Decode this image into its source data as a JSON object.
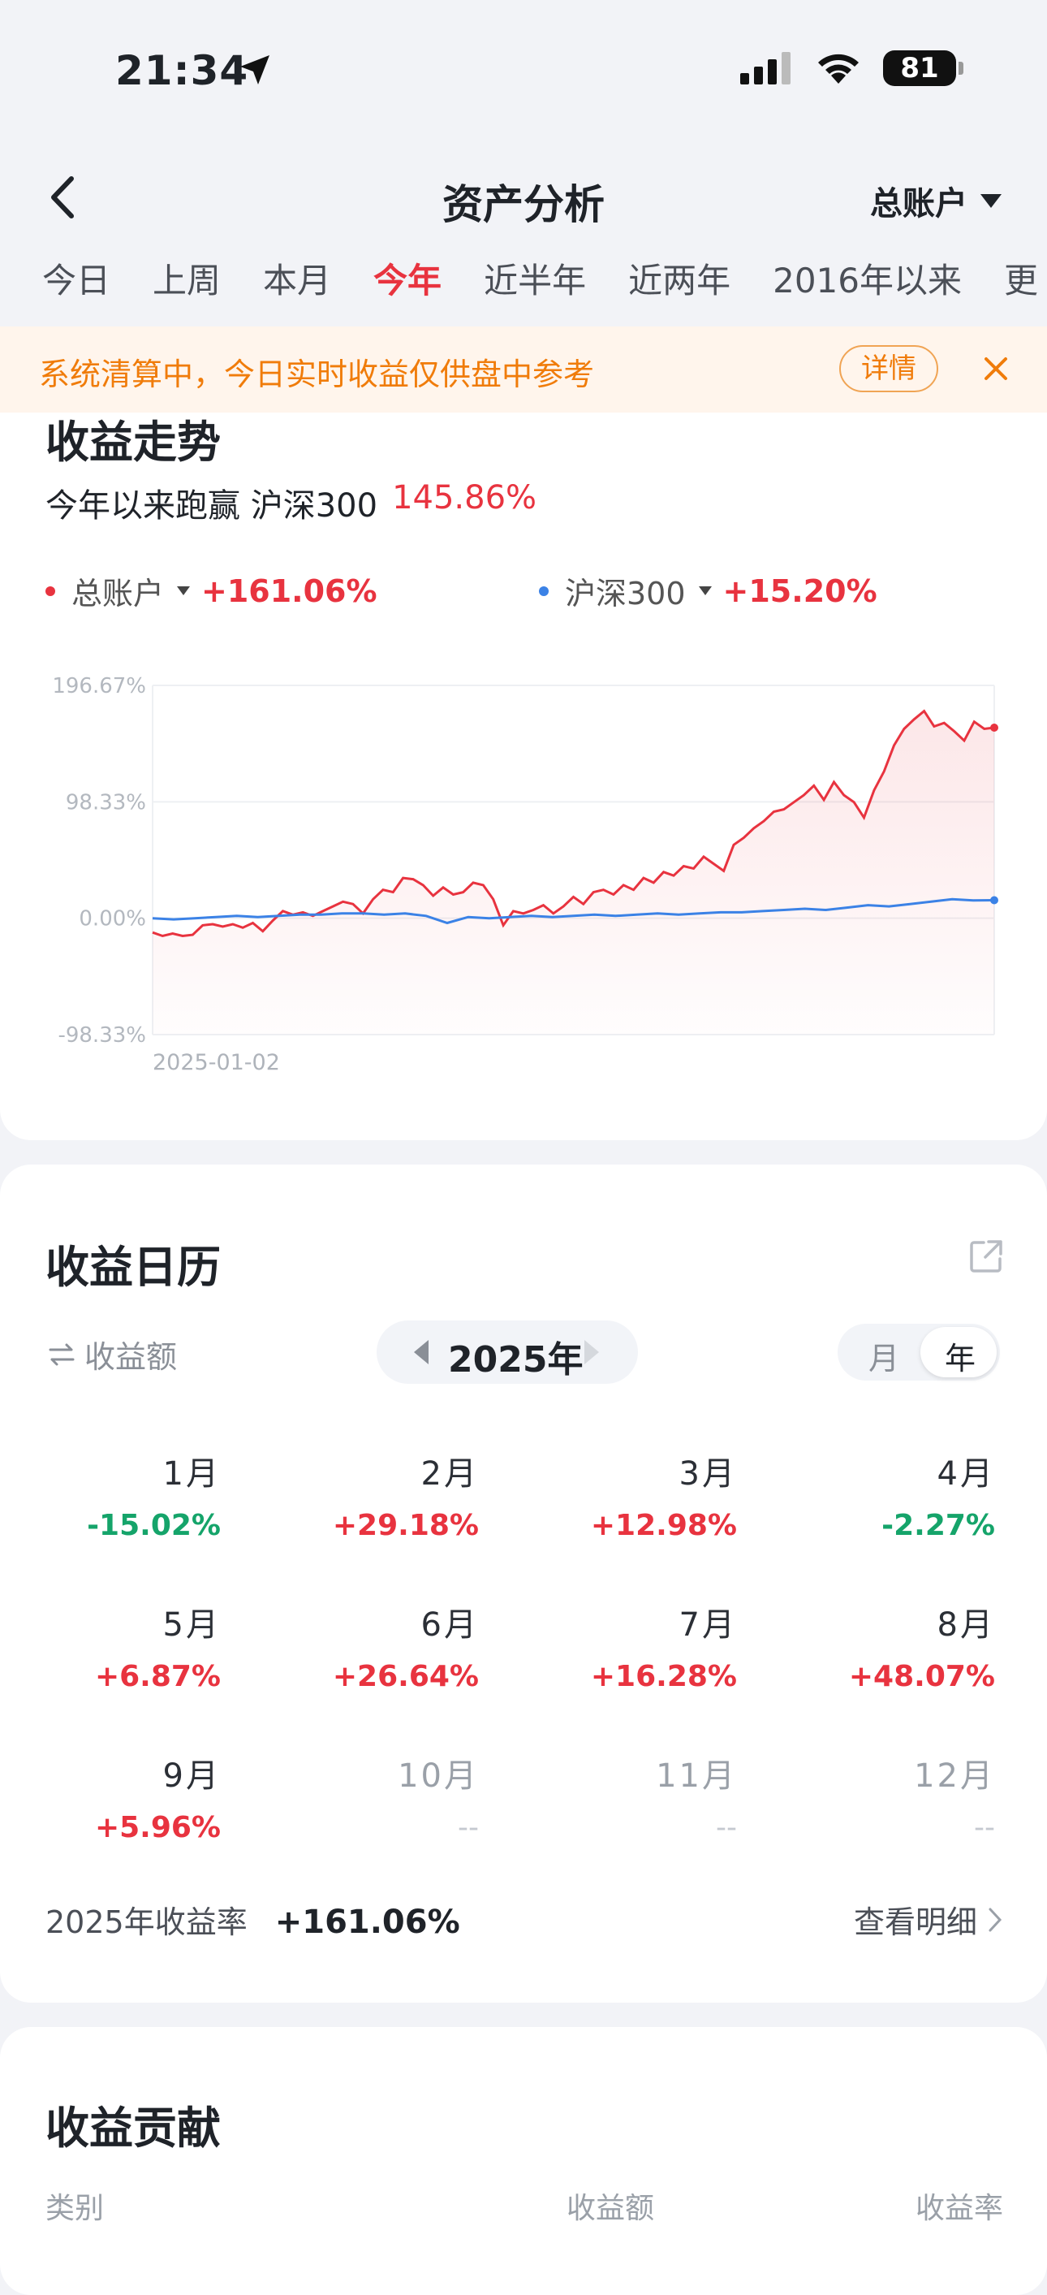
{
  "status_bar": {
    "time": "21:34",
    "battery": "81"
  },
  "nav": {
    "title": "资产分析",
    "account": "总账户"
  },
  "tabs": [
    {
      "label": "今日"
    },
    {
      "label": "上周"
    },
    {
      "label": "本月"
    },
    {
      "label": "今年",
      "active": true
    },
    {
      "label": "近半年"
    },
    {
      "label": "近两年"
    },
    {
      "label": "2016年以来"
    },
    {
      "label": "更"
    }
  ],
  "notice": {
    "text": "系统清算中，今日实时收益仅供盘中参考",
    "detail_label": "详情"
  },
  "trend": {
    "title": "收益走势",
    "summary_prefix": "今年以来跑赢 沪深300",
    "summary_value": "145.86%",
    "legend": [
      {
        "name": "总账户",
        "value": "+161.06%",
        "color": "#e8333f"
      },
      {
        "name": "沪深300",
        "value": "+15.20%",
        "color": "#3b82e6"
      }
    ]
  },
  "chart_data": {
    "type": "area",
    "ylim": [
      -98.33,
      196.67
    ],
    "y_ticks": [
      "196.67%",
      "98.33%",
      "0.00%",
      "-98.33%"
    ],
    "x_start_label": "2025-01-02",
    "grid": true,
    "series": [
      {
        "name": "总账户",
        "color": "#e8333f",
        "values": [
          -12,
          -15,
          -13,
          -15,
          -14,
          -6,
          -5,
          -7,
          -5,
          -8,
          -4,
          -11,
          -2,
          6,
          3,
          5,
          2,
          6,
          10,
          14,
          12,
          4,
          16,
          24,
          22,
          34,
          33,
          28,
          19,
          26,
          20,
          22,
          30,
          28,
          16,
          -6,
          6,
          4,
          7,
          11,
          4,
          10,
          18,
          12,
          22,
          24,
          20,
          28,
          24,
          34,
          30,
          39,
          36,
          44,
          42,
          52,
          46,
          40,
          62,
          68,
          76,
          82,
          90,
          92,
          98,
          104,
          112,
          100,
          115,
          104,
          98,
          85,
          108,
          124,
          146,
          160,
          168,
          175,
          162,
          165,
          158,
          150,
          166,
          160,
          161
        ]
      },
      {
        "name": "沪深300",
        "color": "#3b82e6",
        "values": [
          0,
          -1,
          0,
          1,
          2,
          1,
          2,
          3,
          3,
          4,
          4,
          3,
          4,
          2,
          -4,
          1,
          0,
          1,
          2,
          1,
          2,
          3,
          2,
          3,
          4,
          3,
          4,
          5,
          5,
          6,
          7,
          8,
          7,
          9,
          11,
          10,
          12,
          14,
          16,
          15,
          15.2
        ]
      }
    ]
  },
  "calendar": {
    "title": "收益日历",
    "mode_label": "收益额",
    "year_label": "2025年",
    "seg_month": "月",
    "seg_year": "年",
    "months": [
      {
        "name": "1月",
        "pct": "-15.02%",
        "tone": "down"
      },
      {
        "name": "2月",
        "pct": "+29.18%",
        "tone": "up"
      },
      {
        "name": "3月",
        "pct": "+12.98%",
        "tone": "up"
      },
      {
        "name": "4月",
        "pct": "-2.27%",
        "tone": "down"
      },
      {
        "name": "5月",
        "pct": "+6.87%",
        "tone": "up"
      },
      {
        "name": "6月",
        "pct": "+26.64%",
        "tone": "up"
      },
      {
        "name": "7月",
        "pct": "+16.28%",
        "tone": "up"
      },
      {
        "name": "8月",
        "pct": "+48.07%",
        "tone": "up"
      },
      {
        "name": "9月",
        "pct": "+5.96%",
        "tone": "up"
      },
      {
        "name": "10月",
        "pct": "--",
        "tone": "none"
      },
      {
        "name": "11月",
        "pct": "--",
        "tone": "none"
      },
      {
        "name": "12月",
        "pct": "--",
        "tone": "none"
      }
    ],
    "annual_label": "2025年收益率",
    "annual_value": "+161.06%",
    "view_detail": "查看明细"
  },
  "contribution": {
    "title": "收益贡献",
    "columns": [
      "类别",
      "收益额",
      "收益率"
    ]
  }
}
